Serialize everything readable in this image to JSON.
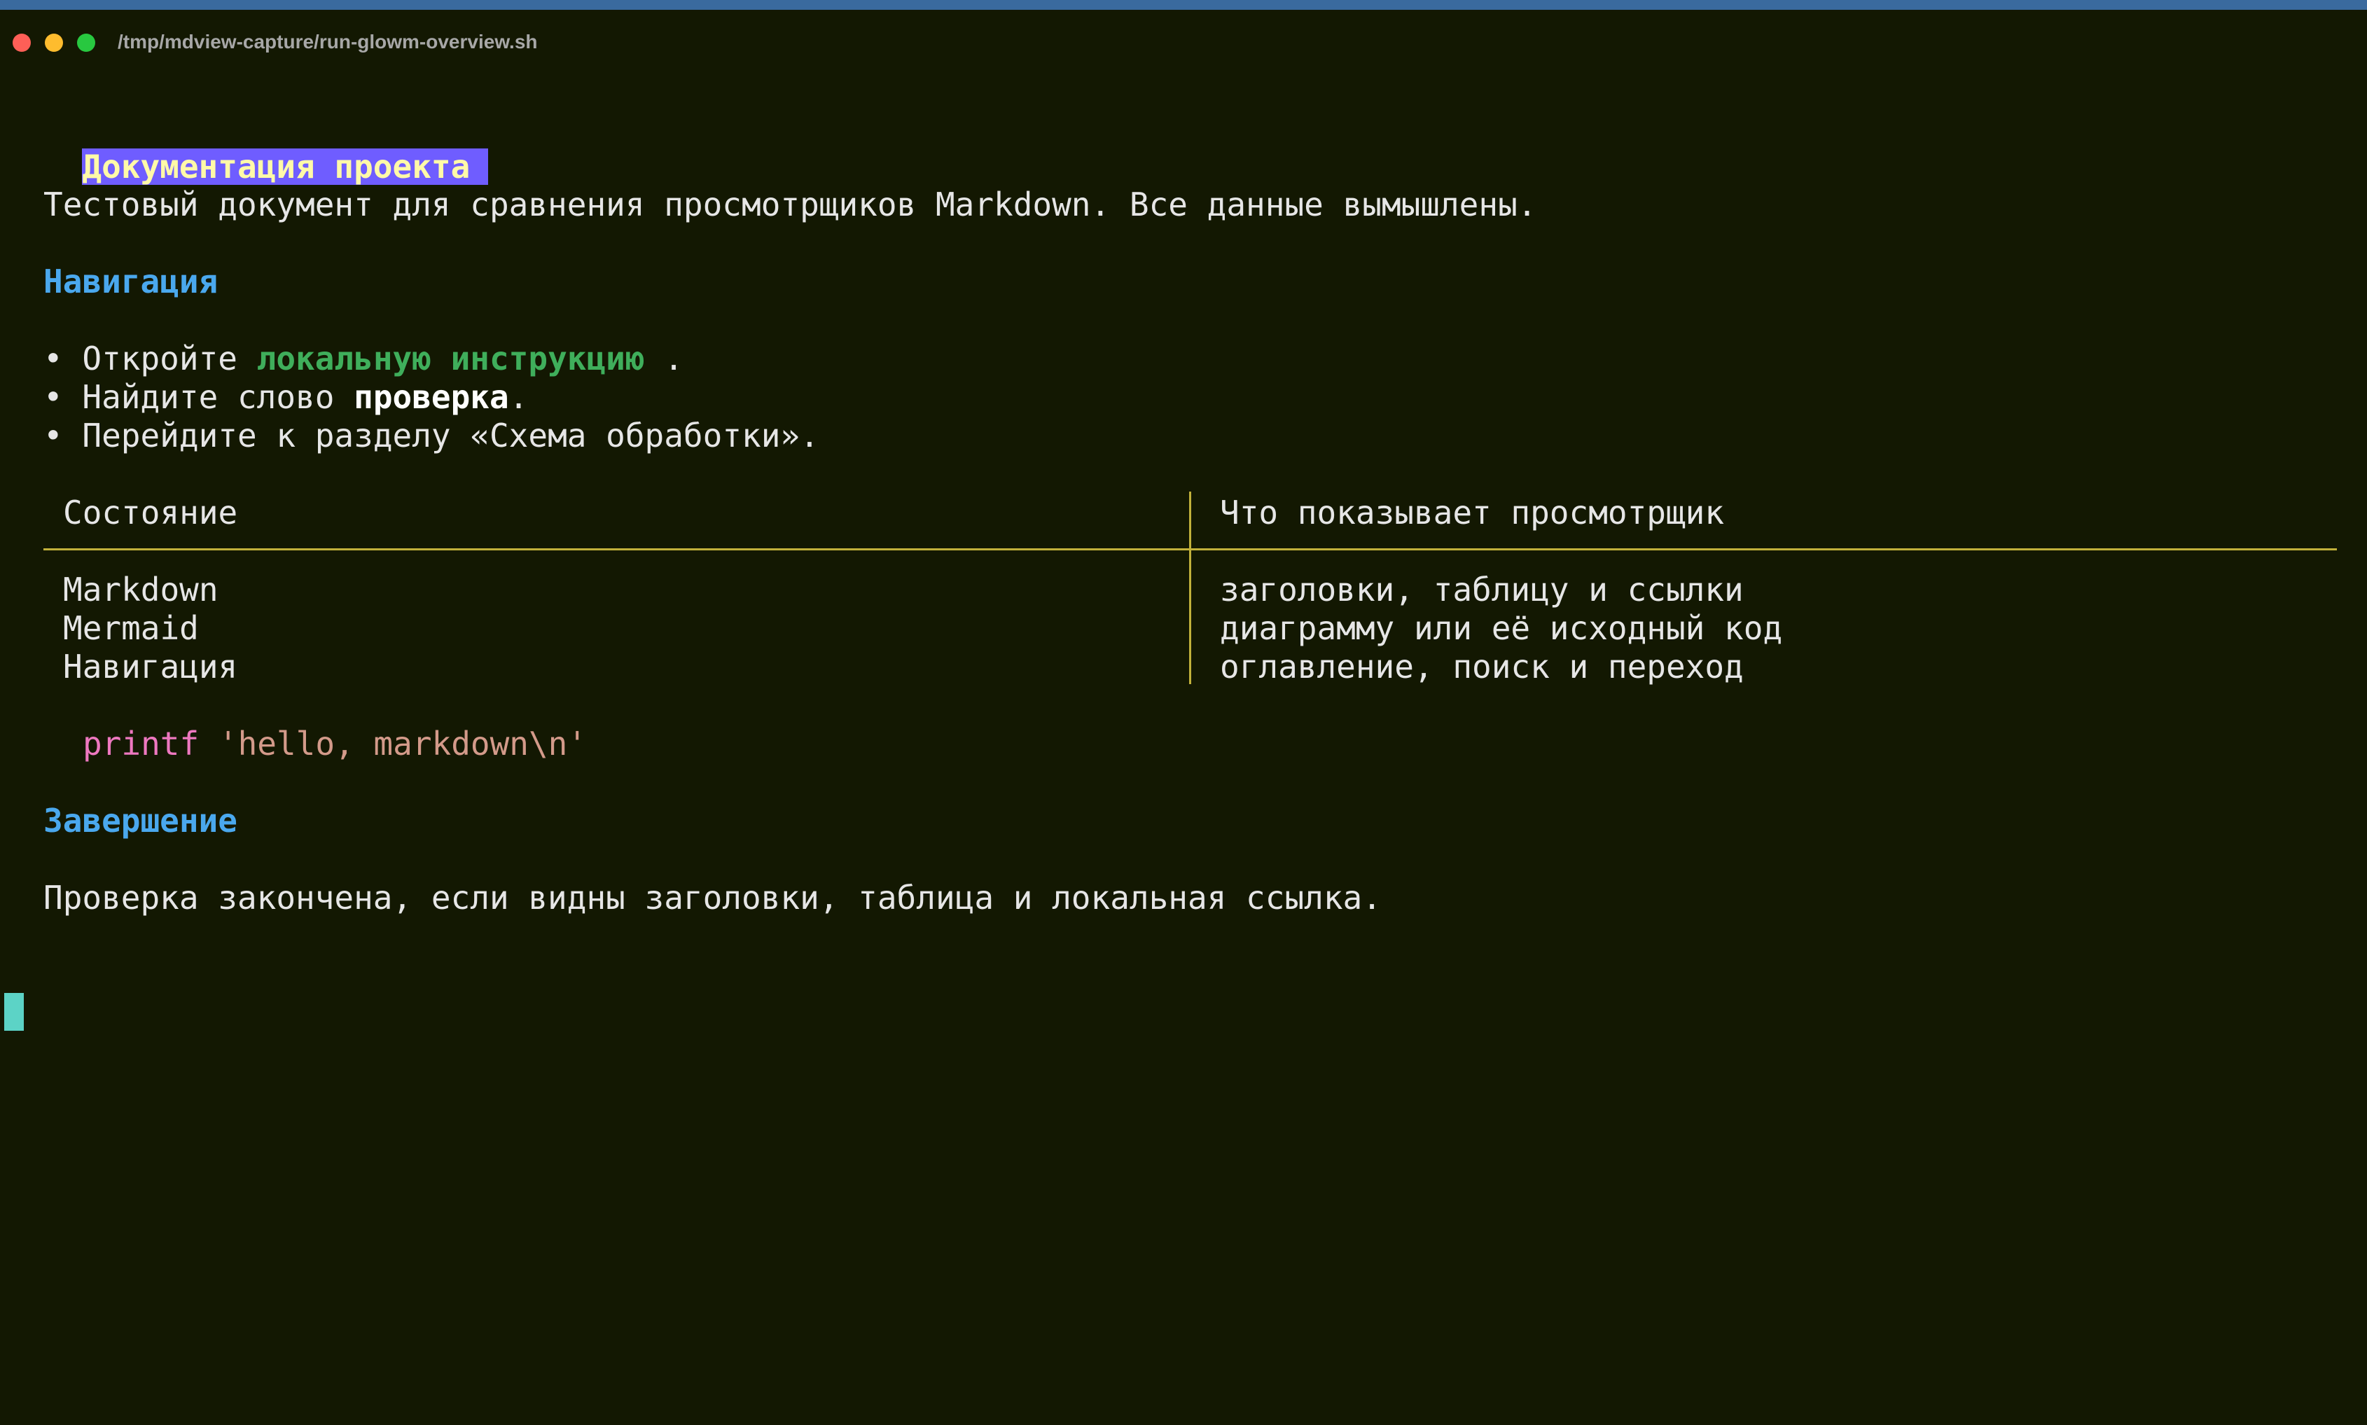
{
  "window": {
    "title": "/tmp/mdview-capture/run-glowm-overview.sh",
    "colors": {
      "background": "#131802",
      "heading": "#4aa8ee",
      "link": "#3fae5b",
      "rule": "#c2b13b"
    }
  },
  "document": {
    "title": "Документация проекта",
    "intro": "Тестовый документ для сравнения просмотрщиков Markdown. Все данные вымышлены.",
    "nav_heading": "Навигация",
    "bullets": [
      {
        "marker": "•",
        "before": "Откройте ",
        "link": "локальную инструкцию",
        "after": " ."
      },
      {
        "marker": "•",
        "before": "Найдите слово ",
        "bold": "проверка",
        "after": "."
      },
      {
        "marker": "•",
        "text": "Перейдите к разделу «Схема обработки»."
      }
    ],
    "table": {
      "headers": [
        "Состояние",
        "Что показывает просмотрщик"
      ],
      "rows": [
        [
          "Markdown",
          "заголовки, таблицу и ссылки"
        ],
        [
          "Mermaid",
          "диаграмму или её исходный код"
        ],
        [
          "Навигация",
          "оглавление, поиск и переход"
        ]
      ]
    },
    "code": {
      "command": "printf",
      "argument": "'hello, markdown\\n'"
    },
    "end_heading": "Завершение",
    "conclusion": "Проверка закончена, если видны заголовки, таблица и локальная ссылка."
  }
}
